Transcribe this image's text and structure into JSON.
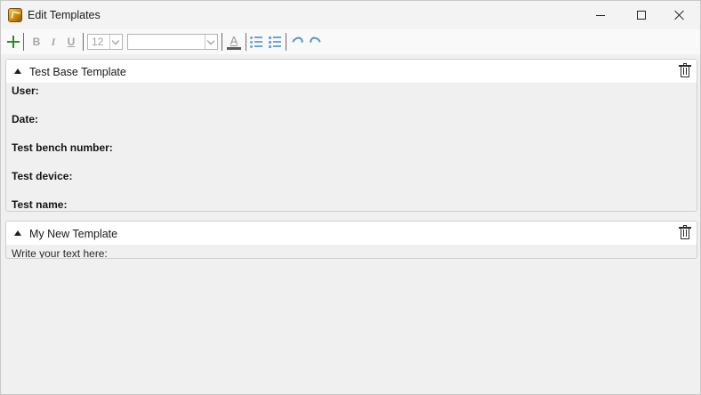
{
  "window": {
    "title": "Edit Templates",
    "app_icon": "app-logo-icon",
    "controls": [
      "minimize-icon",
      "maximize-icon",
      "close-icon"
    ]
  },
  "toolbar": {
    "add_icon": "plus-icon",
    "bold_label": "B",
    "italic_label": "I",
    "underline_label": "U",
    "font_size_value": "12",
    "font_family_value": "",
    "font_color_label": "A",
    "icons": [
      "bulleted-list-icon",
      "numbered-list-icon",
      "undo-icon",
      "redo-icon"
    ],
    "accent_color": "#2e8b2e",
    "icon_blue": "#5c93c4"
  },
  "templates": [
    {
      "title": "Test Base Template",
      "expanded": true,
      "fields": [
        "User:",
        "Date:",
        "Test bench number:",
        "Test device:",
        "Test name:"
      ]
    },
    {
      "title": "My New Template",
      "expanded": true,
      "body_text": "Write your text here:"
    }
  ]
}
